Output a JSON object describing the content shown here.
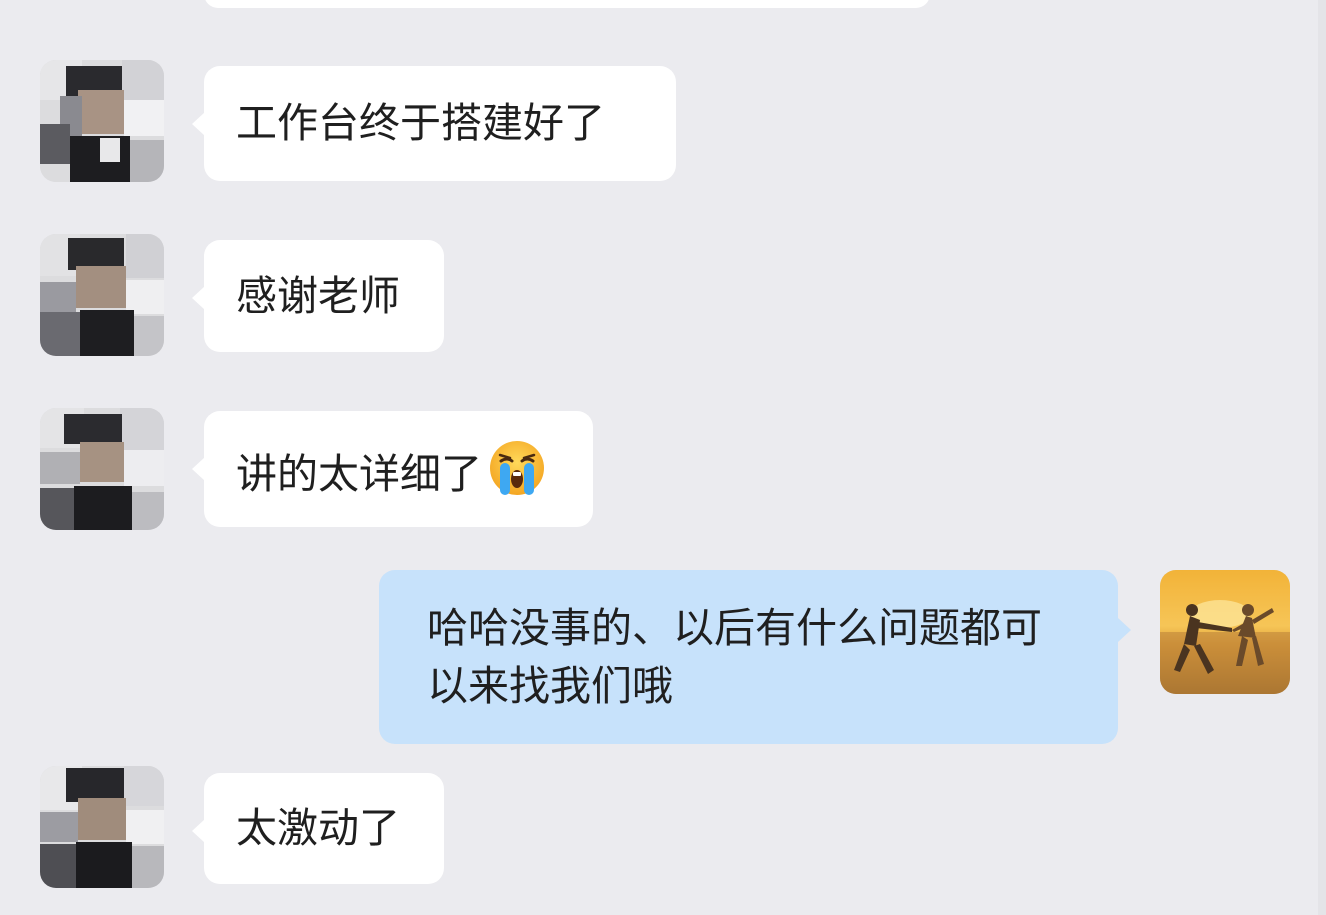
{
  "messages": [
    {
      "sender": "other",
      "text": "工作台终于搭建好了"
    },
    {
      "sender": "other",
      "text": "感谢老师"
    },
    {
      "sender": "other",
      "text": "讲的太详细了",
      "emoji": "crying-face-icon"
    },
    {
      "sender": "self",
      "text": "哈哈没事的、以后有什么问题都可以来找我们哦"
    },
    {
      "sender": "other",
      "text": "太激动了"
    }
  ],
  "colors": {
    "background": "#ebebef",
    "incoming_bubble": "#ffffff",
    "outgoing_bubble": "#c7e2fb",
    "text": "#1f1f1f"
  }
}
